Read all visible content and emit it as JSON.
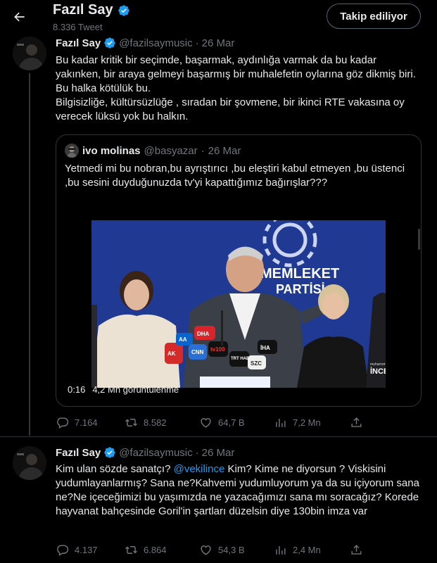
{
  "header": {
    "profile_name": "Fazıl Say",
    "tweet_count": "8.336 Tweet",
    "follow_label": "Takip ediliyor"
  },
  "colors": {
    "accent": "#1d9bf0",
    "text": "#e7e9ea",
    "muted": "#71767b",
    "border": "#2f3336"
  },
  "tweets": [
    {
      "name": "Fazıl Say",
      "handle": "@fazilsaymusic",
      "dot": "·",
      "date": "26 Mar",
      "text_1": "Bu kadar kritik bir seçimde, başarmak, aydınlığa varmak da bu kadar yakınken, bir araya gelmeyi başarmış bir muhalefetin oylarına göz dikmiş biri. Bu halka kötülük bu.",
      "text_2": "Bilgisizliğe, kültürsüzlüğe , sıradan bir şovmene, bir ikinci RTE vakasına oy verecek lüksü yok bu halkın.",
      "quote": {
        "name": "ivo molinas",
        "handle": "@basyazar",
        "dot": "·",
        "date": "26 Mar",
        "text": "Yetmedi mi bu nobran,bu ayrıştırıcı ,bu eleştiri kabul etmeyen ,bu üstenci ,bu sesini duyduğunuzda tv'yi kapattığımız bağırışlar???",
        "video_time": "0:16",
        "video_views": "4,2 Mn görüntülenme",
        "video_sign_1": "MEMLEKET",
        "video_sign_2": "PARTİSİ",
        "video_watermark_1": "muharrem",
        "video_watermark_2": "İNCE",
        "mic_labels": [
          "DHA",
          "İHA",
          "tv100",
          "TRT HABER",
          "SZC",
          "AA",
          "CNN",
          "AK"
        ]
      },
      "stats": {
        "replies": "7.164",
        "retweets": "8.582",
        "likes": "64,7 B",
        "views": "7,2 Mn"
      }
    },
    {
      "name": "Fazıl Say",
      "handle": "@fazilsaymusic",
      "dot": "·",
      "date": "26 Mar",
      "text_a": "Kim ulan sözde sanatçı? ",
      "mention": "@vekilince",
      "text_b": "  Kim? Kime ne diyorsun ? Viskisini yudumlayanlarmış? Sana ne?Kahvemi yudumluyorum ya da su içiyorum sana ne?Ne içeceğimizi bu yaşımızda ne yazacağımızı sana mı soracağız? Korede hayvanat bahçesinde Goril'in şartları düzelsin diye 130bin imza var",
      "stats": {
        "replies": "4.137",
        "retweets": "6.864",
        "likes": "54,3 B",
        "views": "2,4 Mn"
      }
    }
  ],
  "icons": {
    "back": "back-arrow-icon",
    "verified": "verified-badge-icon",
    "reply": "reply-icon",
    "retweet": "retweet-icon",
    "like": "heart-icon",
    "views": "views-chart-icon",
    "share": "share-icon"
  }
}
